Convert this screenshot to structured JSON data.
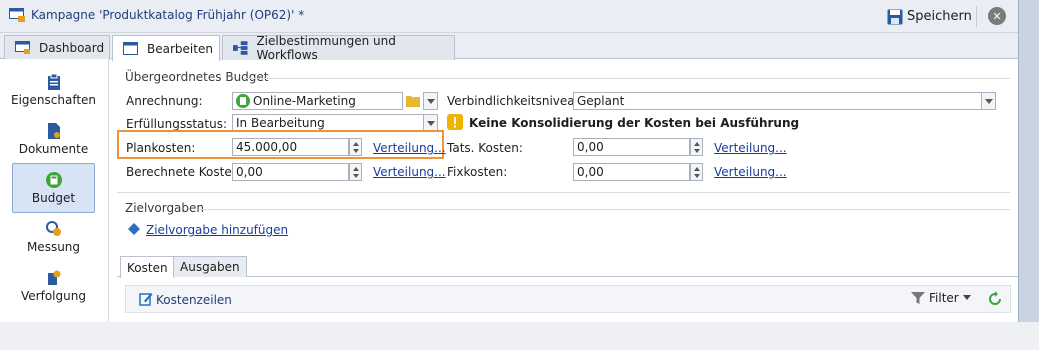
{
  "window": {
    "title": "Kampagne 'Produktkatalog Frühjahr (OP62)' *",
    "save_label": "Speichern",
    "close_symbol": "✕"
  },
  "tabs": [
    {
      "label": "Dashboard",
      "icon": "dashboard-icon"
    },
    {
      "label": "Bearbeiten",
      "icon": "edit-window-icon"
    },
    {
      "label": "Zielbestimmungen und Workflows",
      "icon": "workflow-icon"
    }
  ],
  "sidebar": {
    "items": [
      {
        "label": "Eigenschaften",
        "icon": "clipboard-icon"
      },
      {
        "label": "Dokumente",
        "icon": "document-icon"
      },
      {
        "label": "Budget",
        "icon": "calculator-icon",
        "active": true
      },
      {
        "label": "Messung",
        "icon": "measure-icon"
      },
      {
        "label": "Verfolgung",
        "icon": "tracking-icon"
      }
    ]
  },
  "budget": {
    "group_title": "Übergeordnetes Budget",
    "anrechnung_label": "Anrechnung:",
    "anrechnung_value": "Online-Marketing",
    "verbindlichkeit_label": "Verbindlichkeitsniveau:",
    "verbindlichkeit_value": "Geplant",
    "erfuellung_label": "Erfüllungsstatus:",
    "erfuellung_value": "In Bearbeitung",
    "warning_text": "Keine Konsolidierung der Kosten bei Ausführung",
    "plankosten_label": "Plankosten:",
    "plankosten_value": "45.000,00",
    "tats_label": "Tats. Kosten:",
    "tats_value": "0,00",
    "berechnet_label": "Berechnete Kosten:",
    "berechnet_value": "0,00",
    "fix_label": "Fixkosten:",
    "fix_value": "0,00",
    "verteilung_link": "Verteilung..."
  },
  "zielvorgaben": {
    "group_title": "Zielvorgaben",
    "add_link": "Zielvorgabe hinzufügen"
  },
  "bottom_tabs": [
    "Kosten",
    "Ausgaben"
  ],
  "list": {
    "title": "Kostenzeilen",
    "filter_label": "Filter"
  },
  "colors": {
    "highlight": "#f0923a",
    "link": "#1a3d9c",
    "active_nav": "#d7e4f5"
  }
}
